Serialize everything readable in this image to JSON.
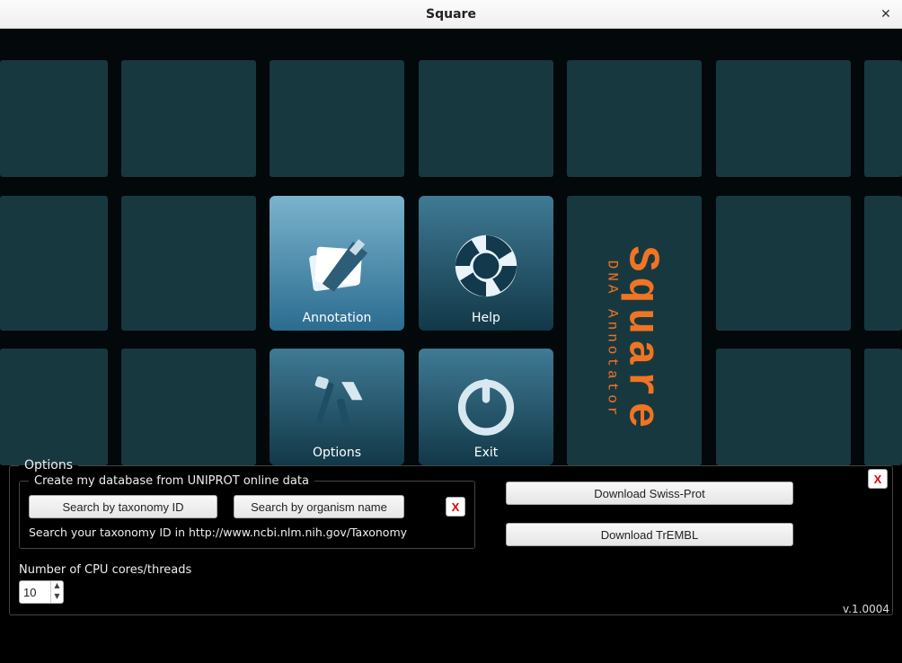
{
  "window": {
    "title": "Square"
  },
  "menu": {
    "annotation": "Annotation",
    "help": "Help",
    "options": "Options",
    "exit": "Exit"
  },
  "logo": {
    "main": "Square",
    "sub": "DNA Annotator"
  },
  "options": {
    "legend": "Options",
    "create_db": {
      "legend": "Create my database from UNIPROT online data",
      "search_tax": "Search by taxonomy ID",
      "search_org": "Search by organism name",
      "hint": "Search your taxonomy ID in http://www.ncbi.nlm.nih.gov/Taxonomy",
      "close": "X"
    },
    "downloads": {
      "swissprot": "Download Swiss-Prot",
      "trembl": "Download TrEMBL"
    },
    "close": "X",
    "cpu": {
      "label": "Number of CPU cores/threads",
      "value": "10"
    }
  },
  "version": "v.1.0004"
}
